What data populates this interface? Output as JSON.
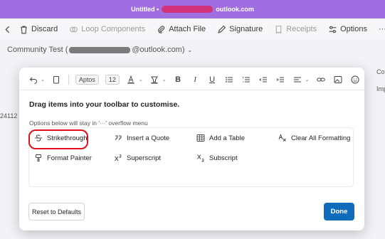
{
  "window": {
    "title_prefix": "Untitled •",
    "title_suffix": "outlook.com"
  },
  "ribbon": {
    "items": [
      {
        "label": "Discard",
        "icon": "trash-icon",
        "enabled": true
      },
      {
        "label": "Loop Components",
        "icon": "loop-icon",
        "enabled": false
      },
      {
        "label": "Attach File",
        "icon": "paperclip-icon",
        "enabled": true
      },
      {
        "label": "Signature",
        "icon": "pen-icon",
        "enabled": true
      },
      {
        "label": "Receipts",
        "icon": "receipt-icon",
        "enabled": false
      },
      {
        "label": "Options",
        "icon": "options-icon",
        "enabled": true
      },
      {
        "label": "···",
        "icon": "more-icon",
        "enabled": true
      }
    ]
  },
  "compose": {
    "from_prefix": "Community Test (",
    "from_suffix": "@outlook.com)",
    "side_left": "24112",
    "side_right_1": "Co",
    "side_right_2": "Imp"
  },
  "modal": {
    "font_name": "Aptos",
    "font_size": "12",
    "heading": "Drag items into your toolbar to customise.",
    "subtext": "Options below will stay in '···' overflow menu",
    "options": [
      {
        "label": "Strikethrough",
        "icon": "strikethrough-icon"
      },
      {
        "label": "Insert a Quote",
        "icon": "quote-icon"
      },
      {
        "label": "Add a Table",
        "icon": "table-icon"
      },
      {
        "label": "Clear All Formatting",
        "icon": "clear-formatting-icon"
      },
      {
        "label": "Format Painter",
        "icon": "format-painter-icon"
      },
      {
        "label": "Superscript",
        "icon": "superscript-icon"
      },
      {
        "label": "Subscript",
        "icon": "subscript-icon"
      }
    ],
    "reset_label": "Reset to Defaults",
    "done_label": "Done"
  },
  "colors": {
    "title_bar": "#a06ee0",
    "primary_button": "#0f6cbd",
    "highlight": "#e0101c"
  }
}
